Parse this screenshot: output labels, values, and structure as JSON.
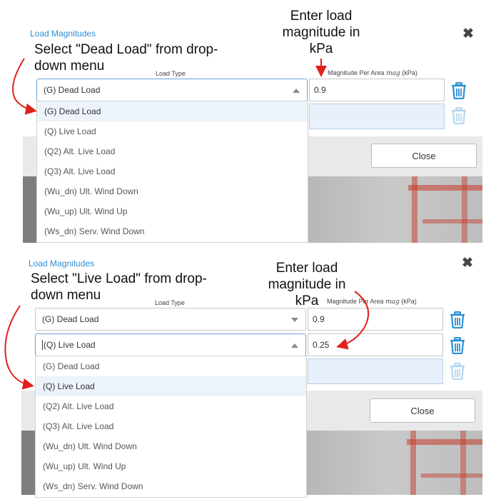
{
  "dialog_title": "Load Magnitudes",
  "close_glyph": "✖",
  "labels": {
    "load_type": "Load Type",
    "magnitude_prefix": "Magnitude Per Area ",
    "magnitude_var": "mag",
    "magnitude_suffix": " (kPa)"
  },
  "close_button_label": "Close",
  "dropdown_options": [
    "(G) Dead Load",
    "(Q) Live Load",
    "(Q2) Alt. Live Load",
    "(Q3) Alt. Live Load",
    "(Wu_dn) Ult. Wind Down",
    "(Wu_up) Ult. Wind Up",
    "(Ws_dn) Serv. Wind Down"
  ],
  "panel1": {
    "annotation_select": "Select \"Dead Load\" from drop-down menu",
    "annotation_enter": "Enter load magnitude in kPa",
    "row1": {
      "type": "(G) Dead Load",
      "magnitude": "0.9"
    },
    "row2": {
      "magnitude": ""
    },
    "highlighted_option": "(G) Dead Load"
  },
  "panel2": {
    "annotation_select": "Select \"Live Load\" from drop-down menu",
    "annotation_enter": "Enter load magnitude in kPa",
    "row1": {
      "type": "(G) Dead Load",
      "magnitude": "0.9"
    },
    "row2": {
      "type": "(Q) Live Load",
      "magnitude": "0.25"
    },
    "row3": {
      "magnitude": ""
    },
    "highlighted_option": "(Q) Live Load"
  },
  "colors": {
    "accent_blue": "#2a8fd6",
    "annotation_red": "#e0201b",
    "highlight_row": "#edf3fa"
  },
  "icons": {
    "delete": "trash-icon",
    "close": "close-icon",
    "dropdown": "caret-icon"
  }
}
